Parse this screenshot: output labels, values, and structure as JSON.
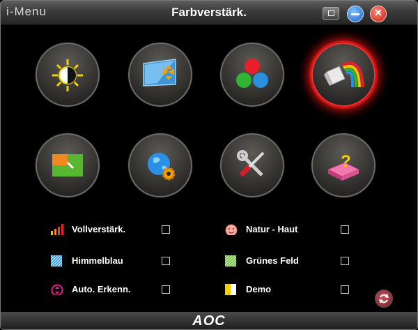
{
  "window": {
    "app_name": "i-Menu",
    "title": "Farbverstärk.",
    "logo": "AOC"
  },
  "titlebar_buttons": [
    "menu-icon",
    "minimize-icon",
    "close-icon"
  ],
  "tiles": [
    {
      "name": "brightness",
      "icon": "sun-contrast-icon"
    },
    {
      "name": "image-setup",
      "icon": "screen-arrows-icon"
    },
    {
      "name": "color-temperature",
      "icon": "rgb-circles-icon"
    },
    {
      "name": "color-boost",
      "icon": "paint-rainbow-icon",
      "active": true
    },
    {
      "name": "picture-boost",
      "icon": "frame-cursor-icon"
    },
    {
      "name": "osd-setup",
      "icon": "globe-gear-icon"
    },
    {
      "name": "extra",
      "icon": "tools-icon"
    },
    {
      "name": "exit",
      "icon": "question-box-icon"
    }
  ],
  "options": {
    "full_enhance": {
      "label": "Vollverstärk.",
      "icon": "signal-bars-icon",
      "checked": false
    },
    "nature_skin": {
      "label": "Natur - Haut",
      "icon": "smiley-icon",
      "checked": false
    },
    "sky_blue": {
      "label": "Himmelblau",
      "icon": "blue-stripes-icon",
      "checked": false
    },
    "green_field": {
      "label": "Grünes Feld",
      "icon": "green-stripes-icon",
      "checked": false
    },
    "auto_detect": {
      "label": "Auto. Erkenn.",
      "icon": "auto-detect-icon",
      "checked": false
    },
    "demo": {
      "label": "Demo",
      "icon": "demo-icon",
      "checked": false
    }
  },
  "colors": {
    "active_glow": "#dd1414",
    "option_text": "#ffffff",
    "background": "#000000"
  }
}
